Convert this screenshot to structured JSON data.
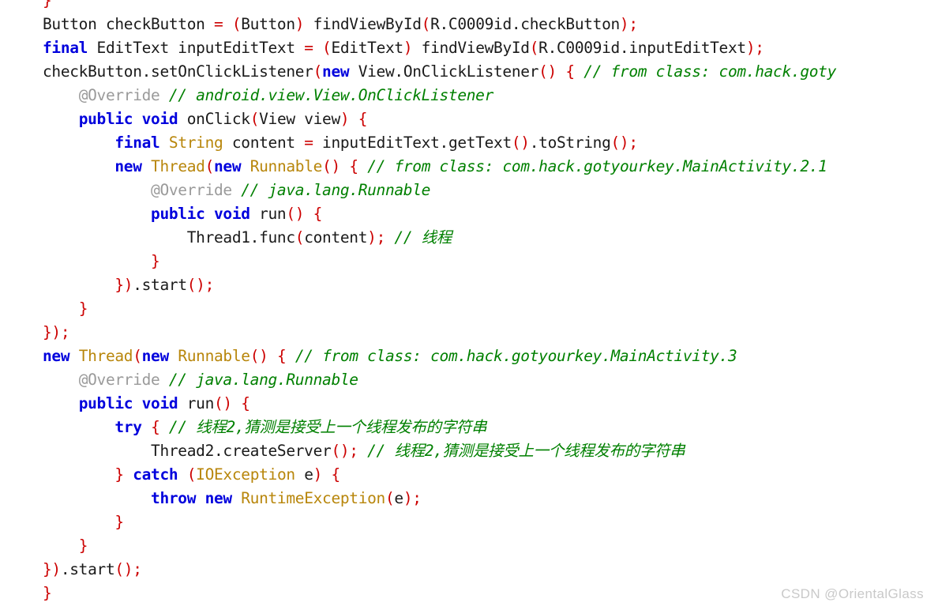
{
  "editor": {
    "language": "java",
    "background_color": "#ffffff",
    "font_size_px": 19.5,
    "line_height_px": 30,
    "syntax_colors": {
      "keyword": "#0000DD",
      "type": "#B8860B",
      "punctuation": "#CC0000",
      "comment": "#008000",
      "annotation": "#9a9a9a",
      "identifier": "#1a1a1a"
    },
    "lines": [
      {
        "index": 0,
        "indent": 0,
        "text": "}",
        "tokens": [
          {
            "t": "}",
            "k": "pn"
          }
        ]
      },
      {
        "index": 1,
        "indent": 0,
        "text": "Button checkButton = (Button) findViewById(R.C0009id.checkButton);",
        "tokens": [
          {
            "t": "Button checkButton ",
            "k": "id"
          },
          {
            "t": "=",
            "k": "pn"
          },
          {
            "t": " ",
            "k": "id"
          },
          {
            "t": "(",
            "k": "pn"
          },
          {
            "t": "Button",
            "k": "id"
          },
          {
            "t": ")",
            "k": "pn"
          },
          {
            "t": " findViewById",
            "k": "id"
          },
          {
            "t": "(",
            "k": "pn"
          },
          {
            "t": "R.C0009id.checkButton",
            "k": "id"
          },
          {
            "t": ");",
            "k": "pn"
          }
        ]
      },
      {
        "index": 2,
        "indent": 0,
        "text": "final EditText inputEditText = (EditText) findViewById(R.C0009id.inputEditText);",
        "tokens": [
          {
            "t": "final",
            "k": "kw"
          },
          {
            "t": " EditText inputEditText ",
            "k": "id"
          },
          {
            "t": "=",
            "k": "pn"
          },
          {
            "t": " ",
            "k": "id"
          },
          {
            "t": "(",
            "k": "pn"
          },
          {
            "t": "EditText",
            "k": "id"
          },
          {
            "t": ")",
            "k": "pn"
          },
          {
            "t": " findViewById",
            "k": "id"
          },
          {
            "t": "(",
            "k": "pn"
          },
          {
            "t": "R.C0009id.inputEditText",
            "k": "id"
          },
          {
            "t": ");",
            "k": "pn"
          }
        ]
      },
      {
        "index": 3,
        "indent": 0,
        "text": "checkButton.setOnClickListener(new View.OnClickListener() { // from class: com.hack.goty",
        "tokens": [
          {
            "t": "checkButton.setOnClickListener",
            "k": "id"
          },
          {
            "t": "(",
            "k": "pn"
          },
          {
            "t": "new",
            "k": "kw"
          },
          {
            "t": " View.OnClickListener",
            "k": "id"
          },
          {
            "t": "()",
            "k": "pn"
          },
          {
            "t": " ",
            "k": "id"
          },
          {
            "t": "{",
            "k": "pn"
          },
          {
            "t": " ",
            "k": "id"
          },
          {
            "t": "// from class: com.hack.goty",
            "k": "cm"
          }
        ]
      },
      {
        "index": 4,
        "indent": 4,
        "text": "    @Override // android.view.View.OnClickListener",
        "tokens": [
          {
            "t": "    ",
            "k": "id"
          },
          {
            "t": "@Override",
            "k": "an"
          },
          {
            "t": " ",
            "k": "id"
          },
          {
            "t": "// android.view.View.OnClickListener",
            "k": "cm"
          }
        ]
      },
      {
        "index": 5,
        "indent": 4,
        "text": "    public void onClick(View view) {",
        "tokens": [
          {
            "t": "    ",
            "k": "id"
          },
          {
            "t": "public void",
            "k": "kw"
          },
          {
            "t": " onClick",
            "k": "id"
          },
          {
            "t": "(",
            "k": "pn"
          },
          {
            "t": "View view",
            "k": "id"
          },
          {
            "t": ")",
            "k": "pn"
          },
          {
            "t": " ",
            "k": "id"
          },
          {
            "t": "{",
            "k": "pn"
          }
        ]
      },
      {
        "index": 6,
        "indent": 8,
        "text": "        final String content = inputEditText.getText().toString();",
        "tokens": [
          {
            "t": "        ",
            "k": "id"
          },
          {
            "t": "final",
            "k": "kw"
          },
          {
            "t": " ",
            "k": "id"
          },
          {
            "t": "String",
            "k": "typ"
          },
          {
            "t": " content ",
            "k": "id"
          },
          {
            "t": "=",
            "k": "pn"
          },
          {
            "t": " inputEditText.getText",
            "k": "id"
          },
          {
            "t": "()",
            "k": "pn"
          },
          {
            "t": ".toString",
            "k": "id"
          },
          {
            "t": "();",
            "k": "pn"
          }
        ]
      },
      {
        "index": 7,
        "indent": 8,
        "text": "        new Thread(new Runnable() { // from class: com.hack.gotyourkey.MainActivity.2.1",
        "tokens": [
          {
            "t": "        ",
            "k": "id"
          },
          {
            "t": "new",
            "k": "kw"
          },
          {
            "t": " ",
            "k": "id"
          },
          {
            "t": "Thread",
            "k": "typ"
          },
          {
            "t": "(",
            "k": "pn"
          },
          {
            "t": "new",
            "k": "kw"
          },
          {
            "t": " ",
            "k": "id"
          },
          {
            "t": "Runnable",
            "k": "typ"
          },
          {
            "t": "()",
            "k": "pn"
          },
          {
            "t": " ",
            "k": "id"
          },
          {
            "t": "{",
            "k": "pn"
          },
          {
            "t": " ",
            "k": "id"
          },
          {
            "t": "// from class: com.hack.gotyourkey.MainActivity.2.1",
            "k": "cm"
          }
        ]
      },
      {
        "index": 8,
        "indent": 12,
        "text": "            @Override // java.lang.Runnable",
        "tokens": [
          {
            "t": "            ",
            "k": "id"
          },
          {
            "t": "@Override",
            "k": "an"
          },
          {
            "t": " ",
            "k": "id"
          },
          {
            "t": "// java.lang.Runnable",
            "k": "cm"
          }
        ]
      },
      {
        "index": 9,
        "indent": 12,
        "text": "            public void run() {",
        "tokens": [
          {
            "t": "            ",
            "k": "id"
          },
          {
            "t": "public void",
            "k": "kw"
          },
          {
            "t": " run",
            "k": "id"
          },
          {
            "t": "()",
            "k": "pn"
          },
          {
            "t": " ",
            "k": "id"
          },
          {
            "t": "{",
            "k": "pn"
          }
        ]
      },
      {
        "index": 10,
        "indent": 16,
        "text": "                Thread1.func(content); // 线程",
        "tokens": [
          {
            "t": "                ",
            "k": "id"
          },
          {
            "t": "Thread1.func",
            "k": "id"
          },
          {
            "t": "(",
            "k": "pn"
          },
          {
            "t": "content",
            "k": "id"
          },
          {
            "t": ");",
            "k": "pn"
          },
          {
            "t": " ",
            "k": "id"
          },
          {
            "t": "// 线程",
            "k": "cm"
          }
        ]
      },
      {
        "index": 11,
        "indent": 12,
        "text": "            }",
        "tokens": [
          {
            "t": "            ",
            "k": "id"
          },
          {
            "t": "}",
            "k": "pn"
          }
        ]
      },
      {
        "index": 12,
        "indent": 8,
        "text": "        }).start();",
        "tokens": [
          {
            "t": "        ",
            "k": "id"
          },
          {
            "t": "})",
            "k": "pn"
          },
          {
            "t": ".start",
            "k": "id"
          },
          {
            "t": "();",
            "k": "pn"
          }
        ]
      },
      {
        "index": 13,
        "indent": 4,
        "text": "    }",
        "tokens": [
          {
            "t": "    ",
            "k": "id"
          },
          {
            "t": "}",
            "k": "pn"
          }
        ]
      },
      {
        "index": 14,
        "indent": 0,
        "text": "});",
        "tokens": [
          {
            "t": "});",
            "k": "pn"
          }
        ]
      },
      {
        "index": 15,
        "indent": 0,
        "text": "new Thread(new Runnable() { // from class: com.hack.gotyourkey.MainActivity.3",
        "tokens": [
          {
            "t": "new",
            "k": "kw"
          },
          {
            "t": " ",
            "k": "id"
          },
          {
            "t": "Thread",
            "k": "typ"
          },
          {
            "t": "(",
            "k": "pn"
          },
          {
            "t": "new",
            "k": "kw"
          },
          {
            "t": " ",
            "k": "id"
          },
          {
            "t": "Runnable",
            "k": "typ"
          },
          {
            "t": "()",
            "k": "pn"
          },
          {
            "t": " ",
            "k": "id"
          },
          {
            "t": "{",
            "k": "pn"
          },
          {
            "t": " ",
            "k": "id"
          },
          {
            "t": "// from class: com.hack.gotyourkey.MainActivity.3",
            "k": "cm"
          }
        ]
      },
      {
        "index": 16,
        "indent": 4,
        "text": "    @Override // java.lang.Runnable",
        "tokens": [
          {
            "t": "    ",
            "k": "id"
          },
          {
            "t": "@Override",
            "k": "an"
          },
          {
            "t": " ",
            "k": "id"
          },
          {
            "t": "// java.lang.Runnable",
            "k": "cm"
          }
        ]
      },
      {
        "index": 17,
        "indent": 4,
        "text": "    public void run() {",
        "tokens": [
          {
            "t": "    ",
            "k": "id"
          },
          {
            "t": "public void",
            "k": "kw"
          },
          {
            "t": " run",
            "k": "id"
          },
          {
            "t": "()",
            "k": "pn"
          },
          {
            "t": " ",
            "k": "id"
          },
          {
            "t": "{",
            "k": "pn"
          }
        ]
      },
      {
        "index": 18,
        "indent": 8,
        "text": "        try { // 线程2,猜测是接受上一个线程发布的字符串",
        "tokens": [
          {
            "t": "        ",
            "k": "id"
          },
          {
            "t": "try",
            "k": "kw"
          },
          {
            "t": " ",
            "k": "id"
          },
          {
            "t": "{",
            "k": "pn"
          },
          {
            "t": " ",
            "k": "id"
          },
          {
            "t": "// 线程2,猜测是接受上一个线程发布的字符串",
            "k": "cm"
          }
        ]
      },
      {
        "index": 19,
        "indent": 12,
        "text": "            Thread2.createServer(); // 线程2,猜测是接受上一个线程发布的字符串",
        "tokens": [
          {
            "t": "            ",
            "k": "id"
          },
          {
            "t": "Thread2.createServer",
            "k": "id"
          },
          {
            "t": "();",
            "k": "pn"
          },
          {
            "t": " ",
            "k": "id"
          },
          {
            "t": "// 线程2,猜测是接受上一个线程发布的字符串",
            "k": "cm"
          }
        ]
      },
      {
        "index": 20,
        "indent": 8,
        "text": "        } catch (IOException e) {",
        "tokens": [
          {
            "t": "        ",
            "k": "id"
          },
          {
            "t": "}",
            "k": "pn"
          },
          {
            "t": " ",
            "k": "id"
          },
          {
            "t": "catch",
            "k": "kw"
          },
          {
            "t": " ",
            "k": "id"
          },
          {
            "t": "(",
            "k": "pn"
          },
          {
            "t": "IOException",
            "k": "typ"
          },
          {
            "t": " e",
            "k": "id"
          },
          {
            "t": ")",
            "k": "pn"
          },
          {
            "t": " ",
            "k": "id"
          },
          {
            "t": "{",
            "k": "pn"
          }
        ]
      },
      {
        "index": 21,
        "indent": 12,
        "text": "            throw new RuntimeException(e);",
        "tokens": [
          {
            "t": "            ",
            "k": "id"
          },
          {
            "t": "throw new",
            "k": "kw"
          },
          {
            "t": " ",
            "k": "id"
          },
          {
            "t": "RuntimeException",
            "k": "typ"
          },
          {
            "t": "(",
            "k": "pn"
          },
          {
            "t": "e",
            "k": "id"
          },
          {
            "t": ");",
            "k": "pn"
          }
        ]
      },
      {
        "index": 22,
        "indent": 8,
        "text": "        }",
        "tokens": [
          {
            "t": "        ",
            "k": "id"
          },
          {
            "t": "}",
            "k": "pn"
          }
        ]
      },
      {
        "index": 23,
        "indent": 4,
        "text": "    }",
        "tokens": [
          {
            "t": "    ",
            "k": "id"
          },
          {
            "t": "}",
            "k": "pn"
          }
        ]
      },
      {
        "index": 24,
        "indent": 0,
        "text": "}).start();",
        "tokens": [
          {
            "t": "})",
            "k": "pn"
          },
          {
            "t": ".start",
            "k": "id"
          },
          {
            "t": "();",
            "k": "pn"
          }
        ]
      },
      {
        "index": 25,
        "indent": 0,
        "text": "}",
        "tokens": [
          {
            "t": "}",
            "k": "pn"
          }
        ]
      }
    ]
  },
  "watermark": {
    "text": "CSDN @OrientalGlass",
    "color": "#c9c9c9"
  }
}
